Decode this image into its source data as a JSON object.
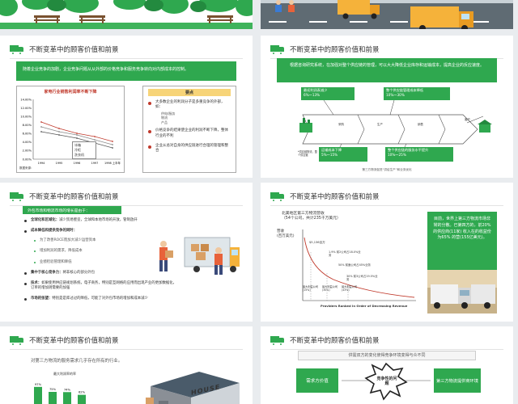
{
  "header_title": "不断变革中的顾客价值和前景",
  "colors": {
    "accent": "#2fa84f",
    "road": "#5f6b73",
    "truck_body": "#f5b23a"
  },
  "slide2": {
    "banner": "随着企业竞争的加剧，企业竞争问题从从外部的价格竞争和服务竞争转向对内部成本的控制。",
    "chart_title": "家电行业销售利润率不断下降",
    "chart_y_ticks": [
      "14.00%",
      "12.00%",
      "10.00%",
      "8.00%",
      "6.00%",
      "4.00%",
      "2.00%",
      "0.00%"
    ],
    "chart_x_ticks": [
      "1994",
      "1995",
      "1996",
      "1997",
      "1998 上半年"
    ],
    "chart_legend": [
      "冰箱",
      "冷柜",
      "洗衣机"
    ],
    "chart_source": "数据来源：",
    "key_points_title": "要点",
    "key_points": [
      "大多数企业的利润分子是多重竞争的外部，如：",
      "价格竞争的结果使企业的利润不断下降，整体行业的不利",
      "企业从总对自身的供应链进行合理的管理和整合"
    ],
    "key_points_sub": [
      "供电/服务",
      "物流",
      "产品"
    ]
  },
  "slide3": {
    "banner": "根据咨询研究系统，在加强对整个供应链的管理，可以大大降低企业库存和运输成本，提高企业的反应速度。",
    "box_top_left": [
      "最初利润表减少",
      "6%～13%"
    ],
    "box_top_right": [
      "整个供应链管理成本降低",
      "10%～30%"
    ],
    "box_bottom_left": [
      "运输成本下降",
      "5%～15%"
    ],
    "box_bottom_right": [
      "整个供应链的服务水平提升",
      "10%～25%"
    ],
    "flow_labels": [
      "采购",
      "生产",
      "销售",
      "客户"
    ],
    "note": "*供应链物流，整个供应链",
    "caption": "第三方物流促进“供给生产”和业务优化"
  },
  "slide4": {
    "tag": "外包市场和物流市场的增长是由于：",
    "items": [
      {
        "label": "全球化和区域化：",
        "text": "减少贸易壁垒，全球和本地市场的开放，管制放开"
      },
      {
        "label": "成本降低和提供竞争的同时：",
        "text": ""
      },
      {
        "label": "集中于核心竞争力：",
        "text": "将非核心的部分外包"
      },
      {
        "label": "技术：",
        "text": "如果使用供应链规划系统，电子商务，特别是互网络的应用而出现产业的更加数据化，订单的增加则需要的加强"
      },
      {
        "label": "市场的张望：",
        "text": "特别是是库过过的降低，可能了对外包市场的增加和成本减少"
      }
    ],
    "sub_items": [
      "为了改善ROCE而加大减少运营资本",
      "增加利润的需求，降低成本",
      "业绩检验管理和降低"
    ]
  },
  "slide5": {
    "chart_title_line1": "北美地区第三方物流营收",
    "chart_title_line2": "（54个公司，共计235千万美元）",
    "ylabel": "营收",
    "ylabel2": "(百万美元)",
    "xlabel": "Providers Ranked in Order of Decreasing Revenue",
    "annotations": [
      "$5,136百万",
      "1.9% 前2公司占18.0%业务",
      "50% 前面公司占45%业务",
      "30% 前3公司占19.5%业务",
      "最大利益公司 (15%)",
      "最大利益公司 (30%)",
      "最大利益公司 (43%)"
    ],
    "side_text": "目前，世界上第三方物流市场非常的分散。已第四方的，前20%的供应商(11家) 收入在的收益份为65% 的营(155亿美元)。"
  },
  "slide6": {
    "lead": "对第三方物流的服务需求几乎存在所有的行业。",
    "chart_title": "最大利润率的率",
    "bars": [
      {
        "label": "97%",
        "value": 97
      },
      {
        "label": "75%",
        "value": 75
      },
      {
        "label": "74%",
        "value": 74
      },
      {
        "label": "62%",
        "value": 62
      }
    ],
    "warehouse_sign": "HOUSE"
  },
  "slide7": {
    "title_box": "供需双方的变化使得竞争环境变得与众不同",
    "left_box": "需求方价值",
    "right_box": "第三方物流提供商环境",
    "center_label": "竞争性的问题"
  }
}
